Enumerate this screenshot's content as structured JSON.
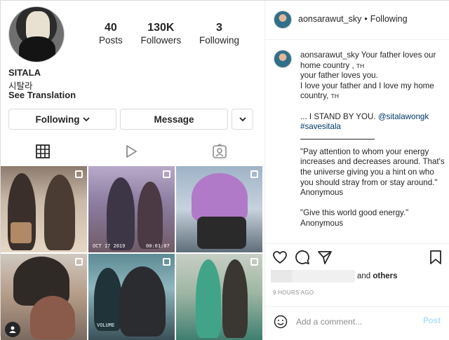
{
  "profile": {
    "stats": [
      {
        "num": "40",
        "label": "Posts"
      },
      {
        "num": "130K",
        "label": "Followers"
      },
      {
        "num": "3",
        "label": "Following"
      }
    ],
    "name": "SITALA",
    "korean_name": "시탈라",
    "see_translation": "See Translation",
    "buttons": {
      "following": "Following",
      "message": "Message"
    },
    "icons": {
      "following_caret": "chevron-down-icon",
      "more": "chevron-down-icon"
    }
  },
  "tabs": [
    {
      "name": "posts-grid-icon",
      "active": true
    },
    {
      "name": "reels-icon",
      "active": false
    },
    {
      "name": "tagged-icon",
      "active": false
    }
  ],
  "grid": {
    "tiles": [
      {
        "multi": true
      },
      {
        "multi": true,
        "stamp_left": "OCT 17 2019",
        "stamp_right": "00:01:07"
      },
      {
        "multi": true
      },
      {
        "multi": true
      },
      {
        "multi": true,
        "volume": "VOLUME"
      },
      {
        "multi": true
      }
    ]
  },
  "post": {
    "header": {
      "username": "aonsarawut_sky",
      "separator": "•",
      "follow_status": "Following"
    },
    "caption": {
      "username": "aonsarawut_sky",
      "lines": [
        "Your father loves our home country ,",
        "your father loves you.",
        "I love your father and I love my home country,"
      ],
      "th_marker": "TH",
      "stand_by": "... I STAND BY YOU.",
      "mention": "@sitalawongk",
      "hashtag": "#savesitala",
      "quote1": "\"Pay attention to whom your energy increases and decreases around. That's the universe giving you a hint on who you should stray from or stay around.\"",
      "attrib1": "Anonymous",
      "quote2": "\"Give this world good energy.\"",
      "attrib2": "Anonymous"
    },
    "likes": {
      "and": "and",
      "others": "others"
    },
    "time": "9 HOURS AGO",
    "comment": {
      "placeholder": "Add a comment...",
      "post_label": "Post"
    }
  },
  "colors": {
    "link": "#00376b",
    "post_disabled": "#b2dffc",
    "muted": "#8e8e8e",
    "border": "#dbdbdb"
  }
}
